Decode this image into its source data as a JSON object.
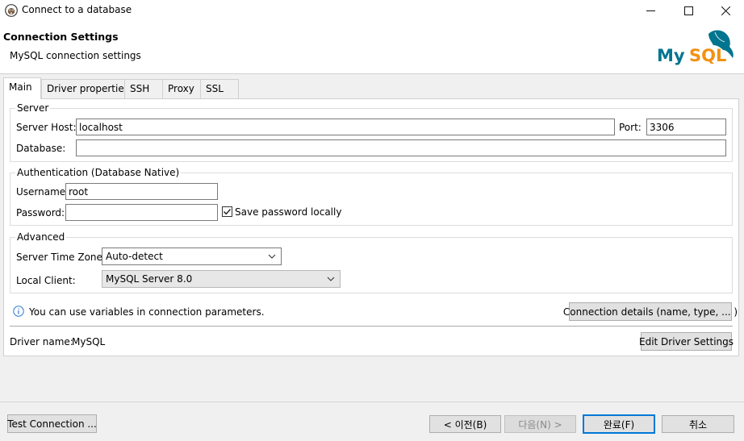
{
  "window": {
    "title": "Connect to a database",
    "minimize_glyph": "—",
    "maximize_glyph": "☐",
    "close_glyph": "✕"
  },
  "header": {
    "title": "Connection Settings",
    "subtitle": "MySQL connection settings",
    "logo_text": "MySQL",
    "logo_colors": {
      "my": "#00758f",
      "sql": "#f29111"
    }
  },
  "tabs": [
    {
      "label": "Main",
      "active": true
    },
    {
      "label": "Driver properties",
      "active": false
    },
    {
      "label": "SSH",
      "active": false
    },
    {
      "label": "Proxy",
      "active": false
    },
    {
      "label": "SSL",
      "active": false
    }
  ],
  "server": {
    "group_label": "Server",
    "host_label": "Server Host:",
    "host_value": "localhost",
    "port_label": "Port:",
    "port_value": "3306",
    "database_label": "Database:",
    "database_value": ""
  },
  "auth": {
    "group_label": "Authentication (Database Native)",
    "username_label": "Username:",
    "username_value": "root",
    "password_label": "Password:",
    "password_value": "",
    "save_password_label": "Save password locally",
    "save_password_checked": true
  },
  "advanced": {
    "group_label": "Advanced",
    "timezone_label": "Server Time Zone:",
    "timezone_value": "Auto-detect",
    "client_label": "Local Client:",
    "client_value": "MySQL Server 8.0"
  },
  "info": {
    "text": "You can use variables in connection parameters.",
    "connection_details_button": "Connection details (name, type, ... )"
  },
  "driver": {
    "label": "Driver name:",
    "value": "MySQL",
    "edit_button": "Edit Driver Settings"
  },
  "footer": {
    "test_button": "Test Connection ...",
    "back_button": "< 이전(B)",
    "next_button": "다음(N) >",
    "finish_button": "완료(F)",
    "cancel_button": "취소"
  }
}
